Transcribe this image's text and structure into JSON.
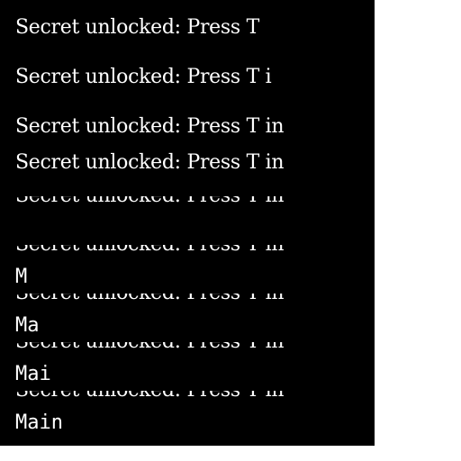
{
  "lines": [
    "Secret unlocked: Press T",
    "Secret unlocked: Press T i",
    "Secret unlocked: Press T in",
    "Secret unlocked: Press T in"
  ],
  "clipped_lines": [
    "Secret unlocked: Press T in",
    "Secret unlocked: Press T in",
    "Secret unlocked: Press T in",
    "Secret unlocked: Press T in",
    "Secret unlocked: Press T in"
  ],
  "input_lines": [
    "M",
    "Ma",
    "Mai",
    "Main"
  ],
  "colors": {
    "background": "#000000",
    "text": "#ffffff",
    "page": "#ffffff"
  }
}
